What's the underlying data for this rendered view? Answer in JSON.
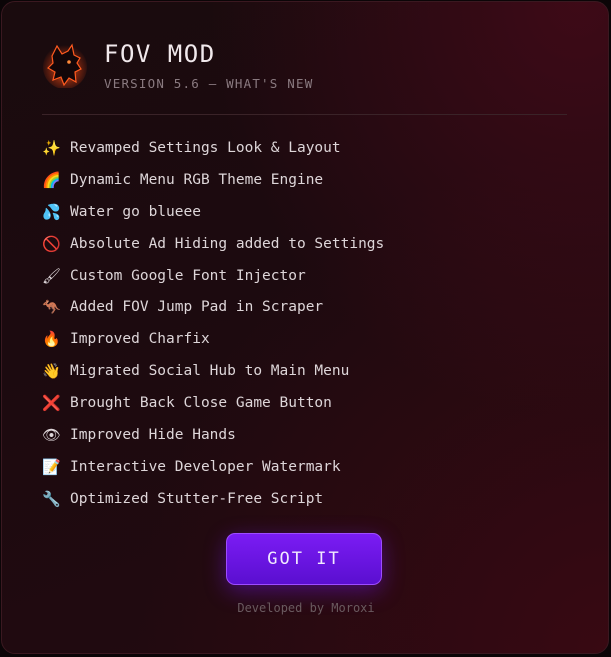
{
  "header": {
    "title": "FOV MOD",
    "subtitle": "VERSION 5.6 — WHAT'S NEW",
    "logo_icon": "fox-silhouette-icon"
  },
  "changelog": {
    "items": [
      {
        "emoji": "✨",
        "icon": "sparkles-icon",
        "label": "Revamped Settings Look & Layout"
      },
      {
        "emoji": "🌈",
        "icon": "rainbow-icon",
        "label": "Dynamic Menu RGB Theme Engine"
      },
      {
        "emoji": "💦",
        "icon": "water-drops-icon",
        "label": "Water go blueee"
      },
      {
        "emoji": "🚫",
        "icon": "prohibited-icon",
        "label": "Absolute Ad Hiding added to Settings"
      },
      {
        "emoji": "🖌",
        "icon": "paintbrush-icon",
        "label": "Custom Google Font Injector"
      },
      {
        "emoji": "🦘",
        "icon": "kangaroo-icon",
        "label": "Added FOV Jump Pad in Scraper"
      },
      {
        "emoji": "🔥",
        "icon": "fire-icon",
        "label": "Improved Charfix"
      },
      {
        "emoji": "👋",
        "icon": "waving-hand-icon",
        "label": "Migrated Social Hub to Main Menu"
      },
      {
        "emoji": "❌",
        "icon": "cross-mark-icon",
        "label": "Brought Back Close Game Button"
      },
      {
        "emoji": "👁",
        "icon": "eye-icon",
        "label": "Improved Hide Hands"
      },
      {
        "emoji": "📝",
        "icon": "memo-icon",
        "label": "Interactive Developer Watermark"
      },
      {
        "emoji": "🔧",
        "icon": "wrench-icon",
        "label": "Optimized Stutter-Free Script"
      }
    ]
  },
  "actions": {
    "got_it_label": "GOT IT"
  },
  "footer": {
    "credit": "Developed by Moroxi"
  },
  "colors": {
    "accent": "#7b1cf4",
    "background": "#1c0a0f",
    "logo_glow": "#ff5a1f"
  }
}
